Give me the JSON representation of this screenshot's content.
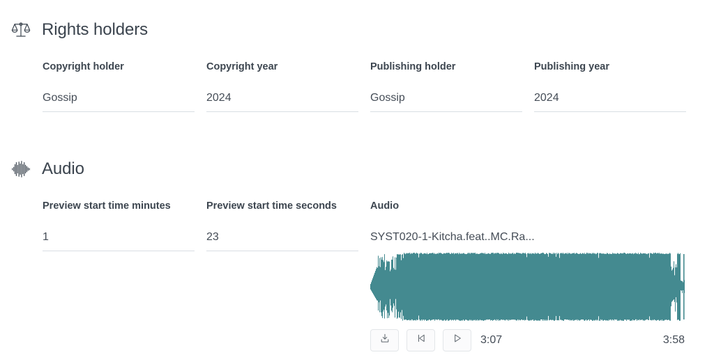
{
  "sections": [
    {
      "id": "rights-holders",
      "icon": "balance-scales-icon",
      "title": "Rights holders",
      "fields": [
        {
          "label": "Copyright holder",
          "value": "Gossip"
        },
        {
          "label": "Copyright year",
          "value": "2024"
        },
        {
          "label": "Publishing holder",
          "value": "Gossip"
        },
        {
          "label": "Publishing year",
          "value": "2024"
        }
      ]
    },
    {
      "id": "audio",
      "icon": "soundwave-icon",
      "title": "Audio",
      "fields": [
        {
          "label": "Preview start time minutes",
          "value": "1"
        },
        {
          "label": "Preview start time seconds",
          "value": "23"
        }
      ],
      "audio": {
        "label": "Audio",
        "filename": "SYST020-1-Kitcha.feat..MC.Ra...",
        "waveform_color": "#448a90",
        "current_time": "3:07",
        "total_time": "3:58",
        "controls": [
          {
            "name": "download-button",
            "icon": "download-icon"
          },
          {
            "name": "restart-button",
            "icon": "skip-to-start-icon"
          },
          {
            "name": "play-button",
            "icon": "play-icon"
          }
        ]
      }
    }
  ]
}
